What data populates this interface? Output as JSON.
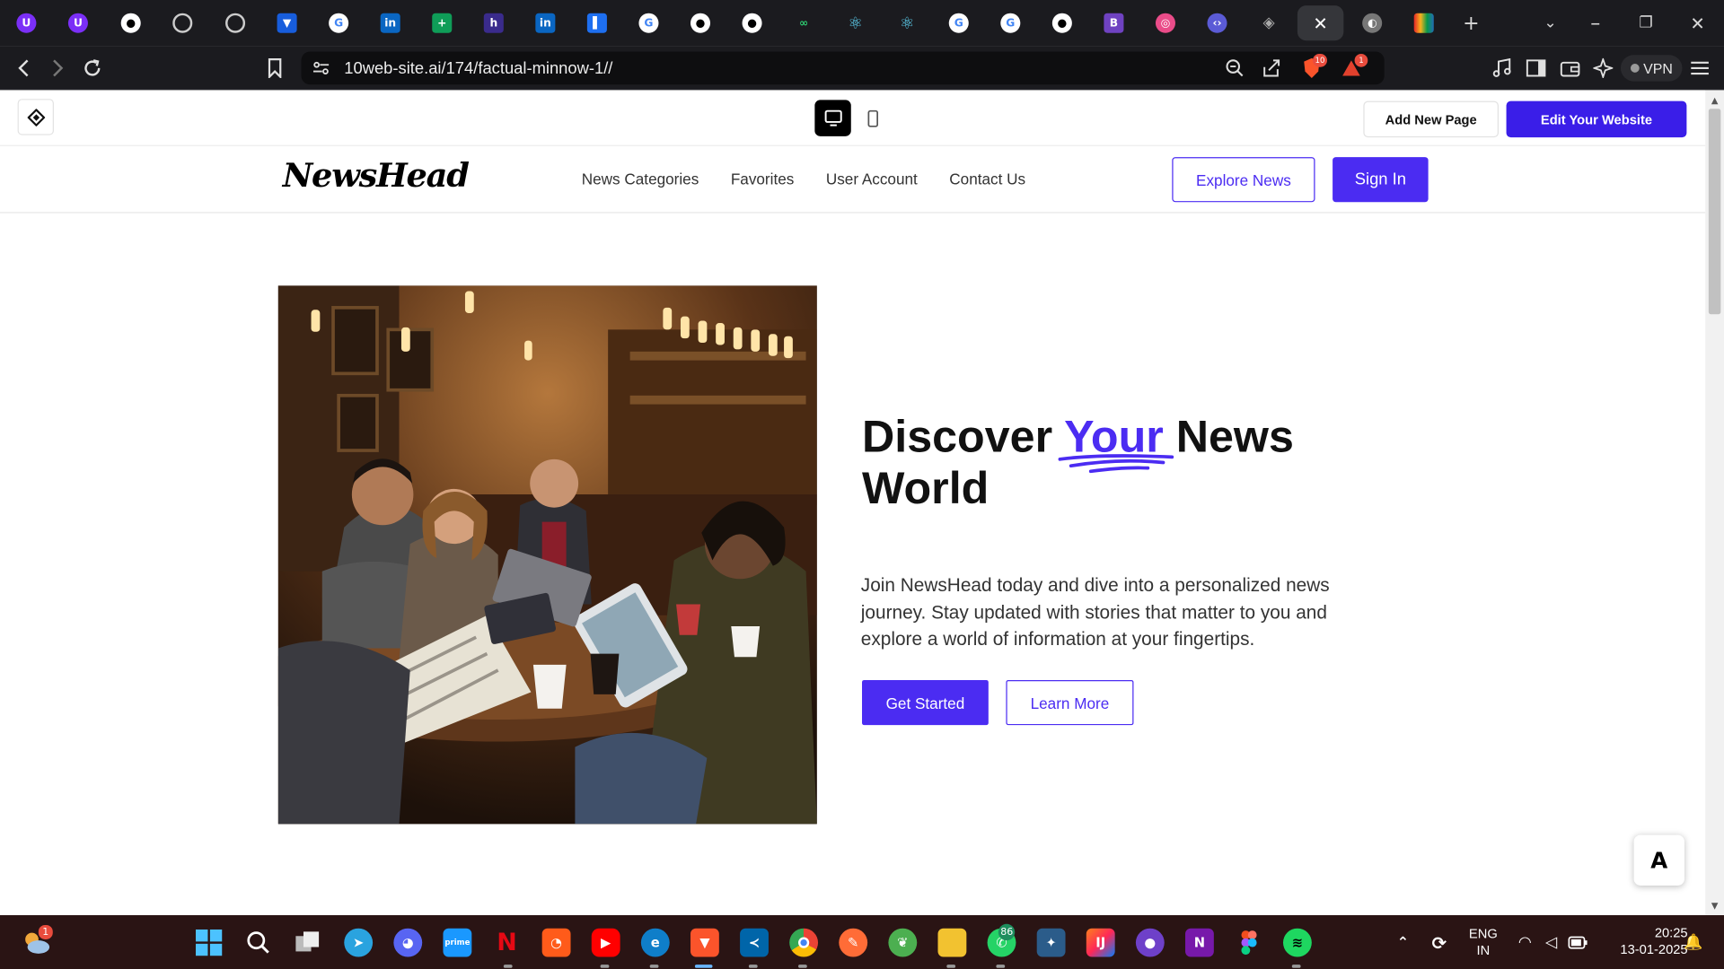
{
  "browser": {
    "url": "10web-site.ai/174/factual-minnow-1//",
    "vpn_label": "VPN",
    "shield_count": "10",
    "alert_count": "1"
  },
  "editor": {
    "add_page_label": "Add New Page",
    "edit_label": "Edit Your Website"
  },
  "site": {
    "brand": "NewsHead",
    "nav": [
      "News Categories",
      "Favorites",
      "User Account",
      "Contact Us"
    ],
    "explore_label": "Explore News",
    "signin_label": "Sign In"
  },
  "hero": {
    "title_pre": "Discover ",
    "title_accent": "Your",
    "title_post": " News World",
    "text": "Join NewsHead today and dive into a personalized news journey. Stay updated with stories that matter to you and explore a world of information at your fingertips.",
    "start_label": "Get Started",
    "learn_label": "Learn More"
  },
  "taskbar": {
    "weather_badge": "1",
    "whatsapp_badge": "86",
    "lang_line1": "ENG",
    "lang_line2": "IN",
    "time": "20:25",
    "date": "13-01-2025"
  },
  "colors": {
    "accent": "#4b2cf2",
    "editor_blue": "#3a1ee8"
  }
}
